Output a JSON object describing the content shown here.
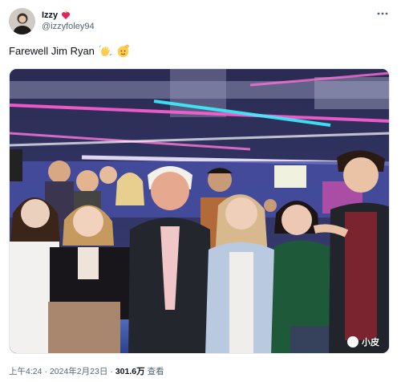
{
  "author": {
    "display_name": "Izzy",
    "handle": "@izzyfoley94",
    "name_emoji": "heart-on-fire"
  },
  "tweet": {
    "text": "Farewell Jim Ryan",
    "emojis": [
      "waving-hand",
      "saluting-face"
    ]
  },
  "photo": {
    "watermark": "小皮"
  },
  "meta": {
    "time": "上午4:24",
    "separator": "·",
    "date": "2024年2月23日",
    "views_count": "301.6万",
    "views_label": "查看"
  },
  "colors": {
    "text_primary": "#0f1419",
    "text_secondary": "#536471",
    "border": "#e5e9ec"
  }
}
